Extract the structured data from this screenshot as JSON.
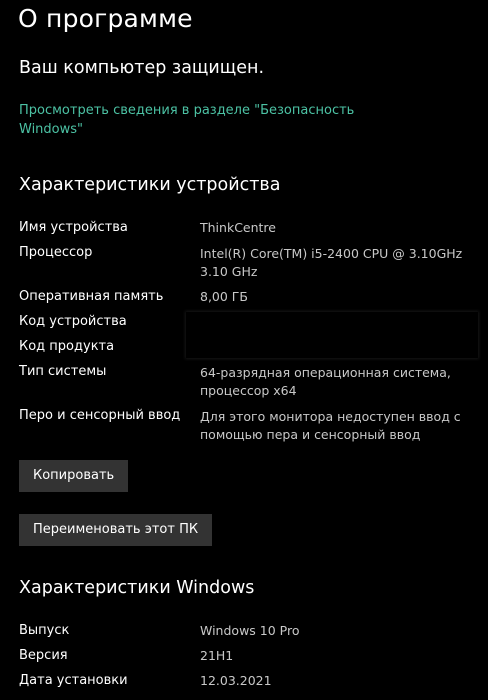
{
  "header": {
    "title": "О программе"
  },
  "security": {
    "status": "Ваш компьютер защищен.",
    "link_text": "Просмотреть сведения в разделе \"Безопасность Windows\""
  },
  "device": {
    "heading": "Характеристики устройства",
    "specs": [
      {
        "label": "Имя устройства",
        "value": "ThinkCentre"
      },
      {
        "label": "Процессор",
        "value": "Intel(R) Core(TM) i5-2400 CPU @ 3.10GHz 3.10 GHz"
      },
      {
        "label": "Оперативная память",
        "value": "8,00 ГБ"
      },
      {
        "label": "Код устройства",
        "value": ""
      },
      {
        "label": "Код продукта",
        "value": ""
      },
      {
        "label": "Тип системы",
        "value": "64-разрядная операционная система, процессор x64"
      },
      {
        "label": "Перо и сенсорный ввод",
        "value": "Для этого монитора недоступен ввод с помощью пера и сенсорный ввод"
      }
    ],
    "copy_button": "Копировать",
    "rename_button": "Переименовать этот ПК"
  },
  "windows": {
    "heading": "Характеристики Windows",
    "specs": [
      {
        "label": "Выпуск",
        "value": "Windows 10 Pro"
      },
      {
        "label": "Версия",
        "value": "21H1"
      },
      {
        "label": "Дата установки",
        "value": "12.03.2021"
      }
    ]
  },
  "colors": {
    "background": "#000000",
    "link": "#4cc2a4",
    "button": "#333333"
  }
}
